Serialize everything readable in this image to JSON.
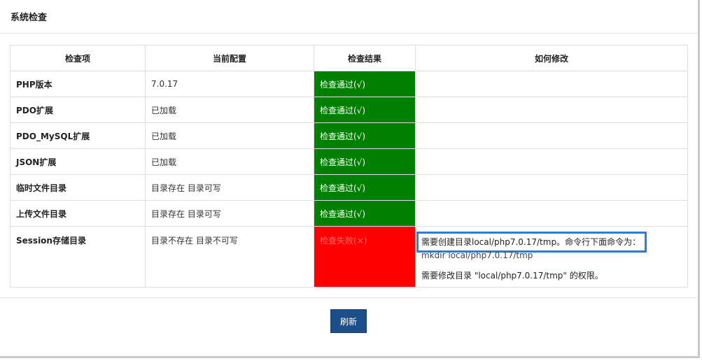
{
  "header": {
    "title": "系统检查"
  },
  "table": {
    "columns": [
      "检查项",
      "当前配置",
      "检查结果",
      "如何修改"
    ],
    "rows": [
      {
        "item": "PHP版本",
        "config": "7.0.17",
        "result": "检查通过(√)",
        "status": "pass",
        "fix": ""
      },
      {
        "item": "PDO扩展",
        "config": "已加载",
        "result": "检查通过(√)",
        "status": "pass",
        "fix": ""
      },
      {
        "item": "PDO_MySQL扩展",
        "config": "已加载",
        "result": "检查通过(√)",
        "status": "pass",
        "fix": ""
      },
      {
        "item": "JSON扩展",
        "config": "已加载",
        "result": "检查通过(√)",
        "status": "pass",
        "fix": ""
      },
      {
        "item": "临时文件目录",
        "config": "目录存在 目录可写",
        "result": "检查通过(√)",
        "status": "pass",
        "fix": ""
      },
      {
        "item": "上传文件目录",
        "config": "目录存在 目录可写",
        "result": "检查通过(√)",
        "status": "pass",
        "fix": ""
      },
      {
        "item": "Session存储目录",
        "config": "目录不存在 目录不可写",
        "result": "检查失败(×)",
        "status": "fail",
        "fix_lines": [
          "需要创建目录local/php7.0.17/tmp。命令行下面命令为：",
          "mkdir local/php7.0.17/tmp",
          "需要修改目录 \"local/php7.0.17/tmp\" 的权限。"
        ]
      }
    ]
  },
  "colors": {
    "pass": "#008000",
    "fail": "#ff0000",
    "highlight_border": "#2a80d5",
    "button": "#1c4f8a"
  },
  "footer": {
    "refresh_label": "刷新"
  }
}
